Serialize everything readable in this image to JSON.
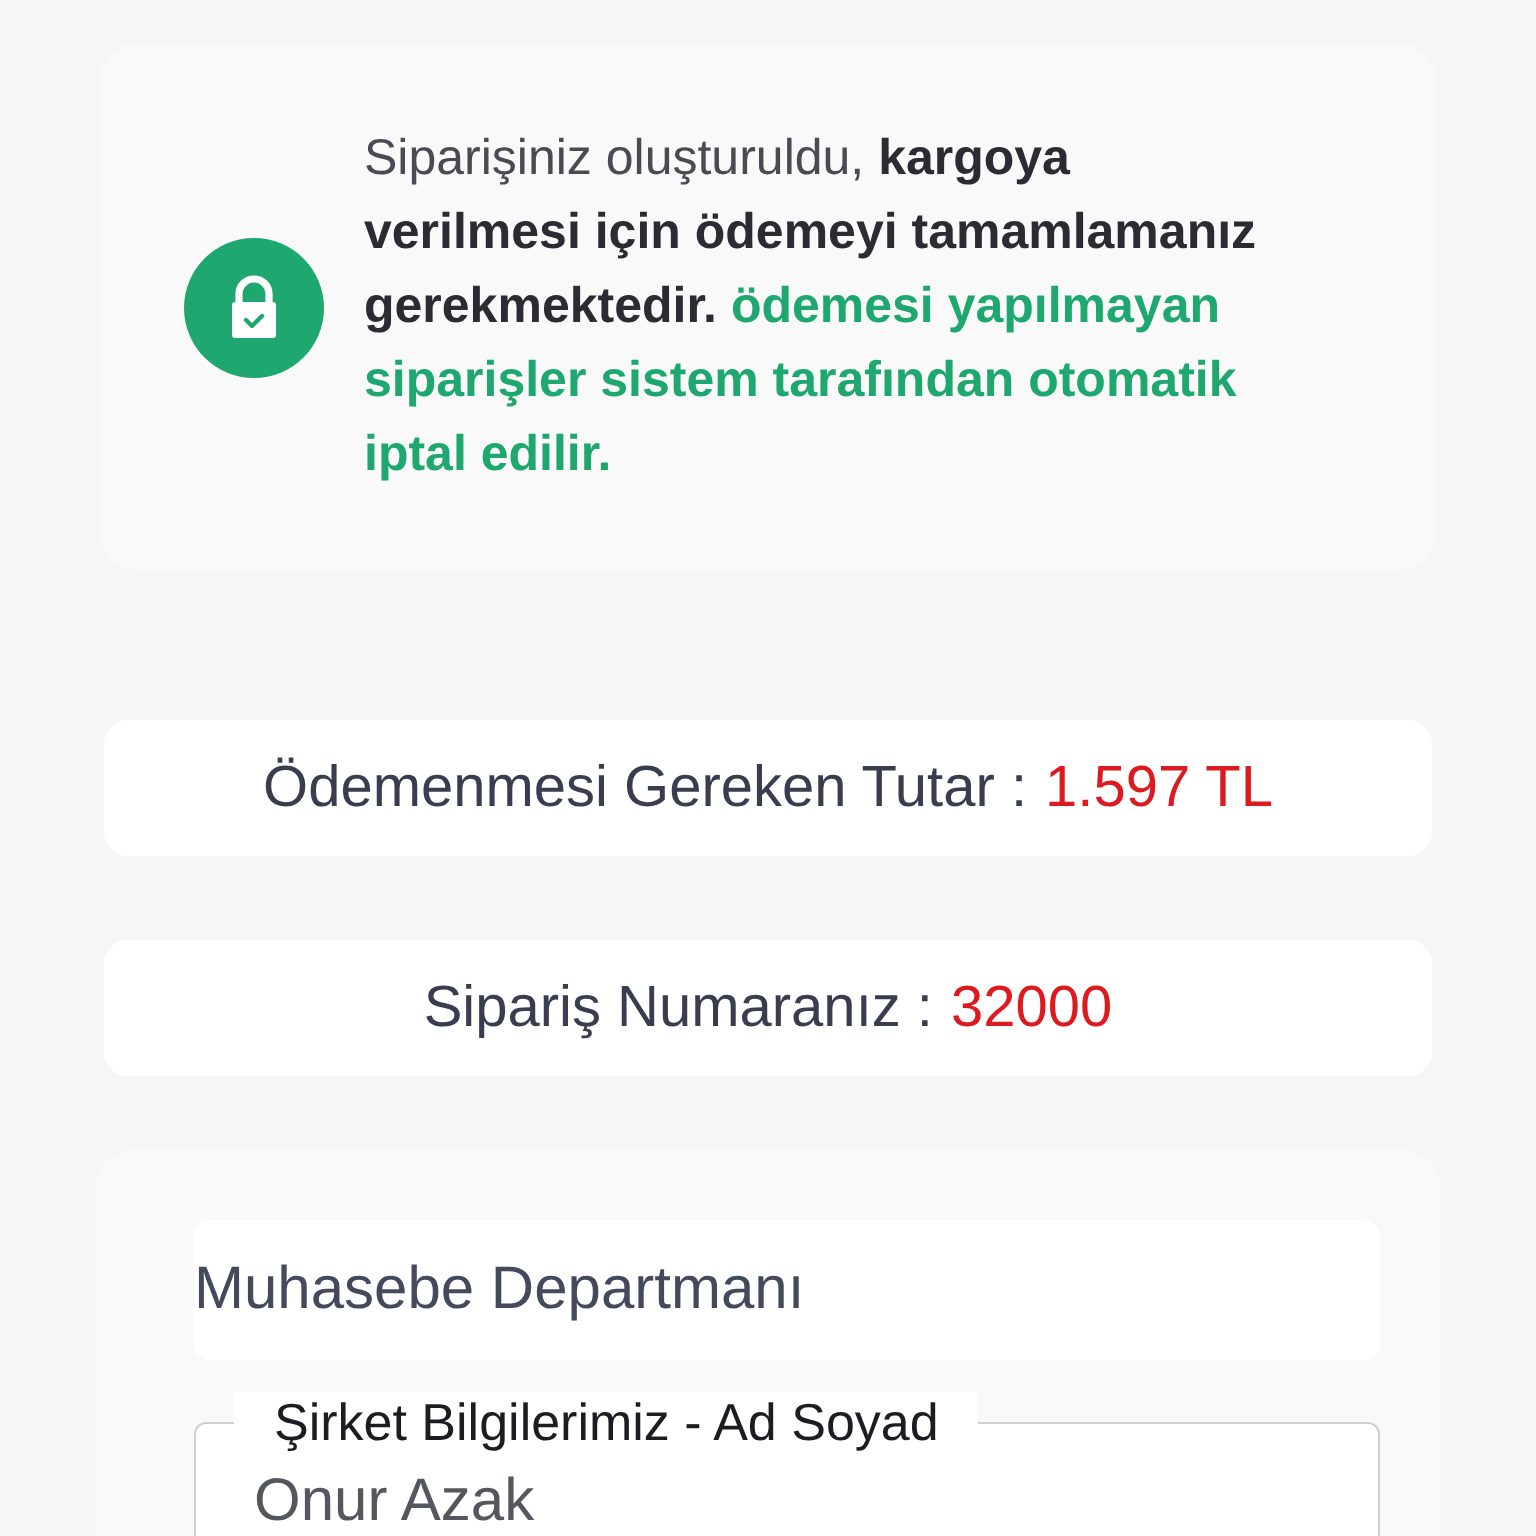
{
  "notice": {
    "segments": [
      {
        "text": "Siparişiniz oluşturuldu, ",
        "kind": "normal"
      },
      {
        "text": "kargoya verilmesi için ödemeyi tamamlamanız gerekmektedir.",
        "kind": "emphasis"
      },
      {
        "text": " ödemesi yapılmayan siparişler sistem tarafından otomatik iptal edilir.",
        "kind": "alert"
      }
    ]
  },
  "summary": [
    {
      "label": "Ödemenmesi Gereken Tutar :",
      "value": "1.597 TL"
    },
    {
      "label": "Sipariş Numaranız :",
      "value": "32000"
    }
  ],
  "form": {
    "department": {
      "value": "Muhasebe Departmanı"
    },
    "name_field": {
      "label": "Şirket Bilgilerimiz - Ad Soyad",
      "value": "Onur Azak"
    }
  }
}
